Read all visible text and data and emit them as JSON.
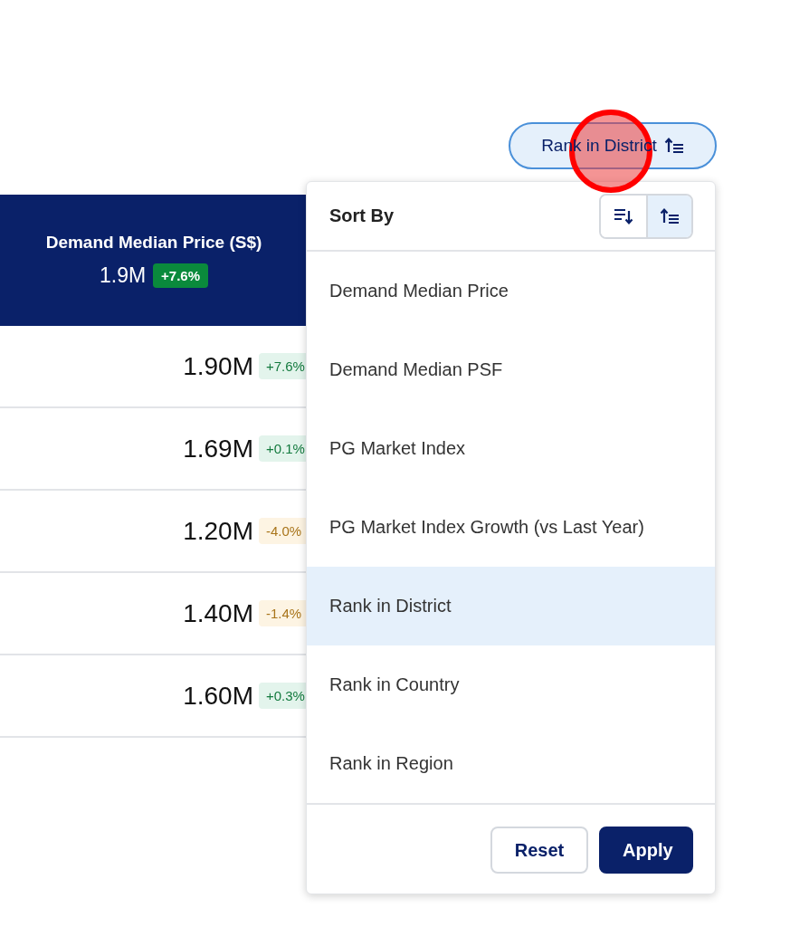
{
  "sort_button": {
    "label": "Rank in District",
    "ascending": true
  },
  "table": {
    "column": {
      "title": "Demand Median Price (S$)",
      "value": "1.9M",
      "change": "+7.6%",
      "positive": true
    },
    "rows": [
      {
        "value": "1.90M",
        "change": "+7.6%",
        "positive": true
      },
      {
        "value": "1.69M",
        "change": "+0.1%",
        "positive": true
      },
      {
        "value": "1.20M",
        "change": "-4.0%",
        "positive": false
      },
      {
        "value": "1.40M",
        "change": "-1.4%",
        "positive": false
      },
      {
        "value": "1.60M",
        "change": "+0.3%",
        "positive": true
      }
    ]
  },
  "sort_menu": {
    "title": "Sort By",
    "directions": [
      {
        "kind": "descending",
        "selected": false
      },
      {
        "kind": "ascending",
        "selected": true
      }
    ],
    "options": [
      {
        "label": "Demand Median Price",
        "selected": false
      },
      {
        "label": "Demand Median PSF",
        "selected": false
      },
      {
        "label": "PG Market Index",
        "selected": false
      },
      {
        "label": "PG Market Index Growth (vs Last Year)",
        "selected": false
      },
      {
        "label": "Rank in District",
        "selected": true
      },
      {
        "label": "Rank in Country",
        "selected": false
      },
      {
        "label": "Rank in Region",
        "selected": false
      }
    ],
    "buttons": [
      {
        "label": "Reset",
        "kind": "secondary"
      },
      {
        "label": "Apply",
        "kind": "primary"
      }
    ]
  }
}
